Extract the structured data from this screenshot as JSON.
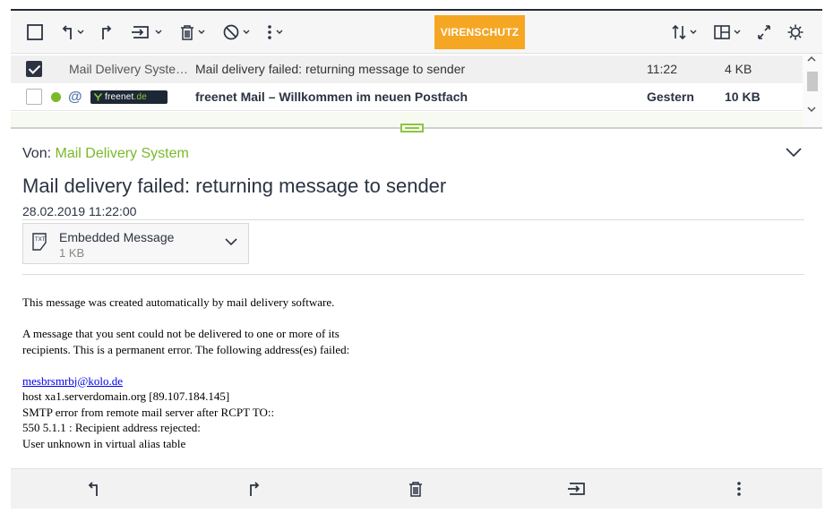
{
  "toolbar": {
    "virus_button": "VIRENSCHUTZ"
  },
  "messages": [
    {
      "sender": "Mail Delivery Syste…",
      "subject": "Mail delivery failed: returning message to sender",
      "time": "11:22",
      "size": "4 KB",
      "selected": true,
      "unread": false
    },
    {
      "sender_brand": "freenet",
      "sender_brand_tld": ".de",
      "subject": "freenet Mail – Willkommen im neuen Postfach",
      "time": "Gestern",
      "size": "10 KB",
      "selected": false,
      "unread": true
    }
  ],
  "reading": {
    "from_label": "Von:",
    "from_name": "Mail Delivery System",
    "subject": "Mail delivery failed: returning message to sender",
    "date": "28.02.2019 11:22:00",
    "attachment": {
      "name": "Embedded Message",
      "size": "1 KB"
    },
    "body": {
      "line1": "This message was created automatically by mail delivery software.",
      "line2": "A message that you sent could not be delivered to one or more of its",
      "line3": "recipients. This is a permanent error. The following address(es) failed:",
      "address": "mesbrsmrbj@kolo.de",
      "line4": "host xa1.serverdomain.org [89.107.184.145]",
      "line5": "SMTP error from remote mail server after RCPT TO::",
      "line6": "550 5.1.1 : Recipient address rejected:",
      "line7": "User unknown in virtual alias table"
    }
  },
  "colors": {
    "accent": "#f5a623",
    "brand_green": "#7ab929",
    "dark": "#2b3342"
  },
  "icons": [
    "checkbox-icon",
    "reply-icon",
    "forward-icon",
    "move-icon",
    "trash-icon",
    "block-icon",
    "more-icon",
    "sort-icon",
    "layout-icon",
    "expand-icon",
    "settings-icon"
  ]
}
